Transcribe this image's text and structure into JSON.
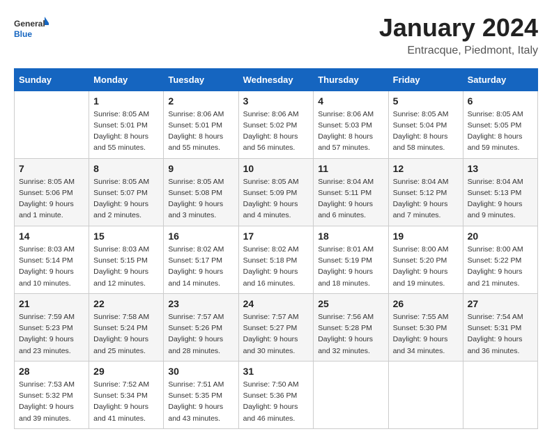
{
  "logo": {
    "general": "General",
    "blue": "Blue"
  },
  "header": {
    "title": "January 2024",
    "subtitle": "Entracque, Piedmont, Italy"
  },
  "columns": [
    "Sunday",
    "Monday",
    "Tuesday",
    "Wednesday",
    "Thursday",
    "Friday",
    "Saturday"
  ],
  "weeks": [
    [
      {
        "day": "",
        "info": ""
      },
      {
        "day": "1",
        "info": "Sunrise: 8:05 AM\nSunset: 5:01 PM\nDaylight: 8 hours\nand 55 minutes."
      },
      {
        "day": "2",
        "info": "Sunrise: 8:06 AM\nSunset: 5:01 PM\nDaylight: 8 hours\nand 55 minutes."
      },
      {
        "day": "3",
        "info": "Sunrise: 8:06 AM\nSunset: 5:02 PM\nDaylight: 8 hours\nand 56 minutes."
      },
      {
        "day": "4",
        "info": "Sunrise: 8:06 AM\nSunset: 5:03 PM\nDaylight: 8 hours\nand 57 minutes."
      },
      {
        "day": "5",
        "info": "Sunrise: 8:05 AM\nSunset: 5:04 PM\nDaylight: 8 hours\nand 58 minutes."
      },
      {
        "day": "6",
        "info": "Sunrise: 8:05 AM\nSunset: 5:05 PM\nDaylight: 8 hours\nand 59 minutes."
      }
    ],
    [
      {
        "day": "7",
        "info": "Sunrise: 8:05 AM\nSunset: 5:06 PM\nDaylight: 9 hours\nand 1 minute."
      },
      {
        "day": "8",
        "info": "Sunrise: 8:05 AM\nSunset: 5:07 PM\nDaylight: 9 hours\nand 2 minutes."
      },
      {
        "day": "9",
        "info": "Sunrise: 8:05 AM\nSunset: 5:08 PM\nDaylight: 9 hours\nand 3 minutes."
      },
      {
        "day": "10",
        "info": "Sunrise: 8:05 AM\nSunset: 5:09 PM\nDaylight: 9 hours\nand 4 minutes."
      },
      {
        "day": "11",
        "info": "Sunrise: 8:04 AM\nSunset: 5:11 PM\nDaylight: 9 hours\nand 6 minutes."
      },
      {
        "day": "12",
        "info": "Sunrise: 8:04 AM\nSunset: 5:12 PM\nDaylight: 9 hours\nand 7 minutes."
      },
      {
        "day": "13",
        "info": "Sunrise: 8:04 AM\nSunset: 5:13 PM\nDaylight: 9 hours\nand 9 minutes."
      }
    ],
    [
      {
        "day": "14",
        "info": "Sunrise: 8:03 AM\nSunset: 5:14 PM\nDaylight: 9 hours\nand 10 minutes."
      },
      {
        "day": "15",
        "info": "Sunrise: 8:03 AM\nSunset: 5:15 PM\nDaylight: 9 hours\nand 12 minutes."
      },
      {
        "day": "16",
        "info": "Sunrise: 8:02 AM\nSunset: 5:17 PM\nDaylight: 9 hours\nand 14 minutes."
      },
      {
        "day": "17",
        "info": "Sunrise: 8:02 AM\nSunset: 5:18 PM\nDaylight: 9 hours\nand 16 minutes."
      },
      {
        "day": "18",
        "info": "Sunrise: 8:01 AM\nSunset: 5:19 PM\nDaylight: 9 hours\nand 18 minutes."
      },
      {
        "day": "19",
        "info": "Sunrise: 8:00 AM\nSunset: 5:20 PM\nDaylight: 9 hours\nand 19 minutes."
      },
      {
        "day": "20",
        "info": "Sunrise: 8:00 AM\nSunset: 5:22 PM\nDaylight: 9 hours\nand 21 minutes."
      }
    ],
    [
      {
        "day": "21",
        "info": "Sunrise: 7:59 AM\nSunset: 5:23 PM\nDaylight: 9 hours\nand 23 minutes."
      },
      {
        "day": "22",
        "info": "Sunrise: 7:58 AM\nSunset: 5:24 PM\nDaylight: 9 hours\nand 25 minutes."
      },
      {
        "day": "23",
        "info": "Sunrise: 7:57 AM\nSunset: 5:26 PM\nDaylight: 9 hours\nand 28 minutes."
      },
      {
        "day": "24",
        "info": "Sunrise: 7:57 AM\nSunset: 5:27 PM\nDaylight: 9 hours\nand 30 minutes."
      },
      {
        "day": "25",
        "info": "Sunrise: 7:56 AM\nSunset: 5:28 PM\nDaylight: 9 hours\nand 32 minutes."
      },
      {
        "day": "26",
        "info": "Sunrise: 7:55 AM\nSunset: 5:30 PM\nDaylight: 9 hours\nand 34 minutes."
      },
      {
        "day": "27",
        "info": "Sunrise: 7:54 AM\nSunset: 5:31 PM\nDaylight: 9 hours\nand 36 minutes."
      }
    ],
    [
      {
        "day": "28",
        "info": "Sunrise: 7:53 AM\nSunset: 5:32 PM\nDaylight: 9 hours\nand 39 minutes."
      },
      {
        "day": "29",
        "info": "Sunrise: 7:52 AM\nSunset: 5:34 PM\nDaylight: 9 hours\nand 41 minutes."
      },
      {
        "day": "30",
        "info": "Sunrise: 7:51 AM\nSunset: 5:35 PM\nDaylight: 9 hours\nand 43 minutes."
      },
      {
        "day": "31",
        "info": "Sunrise: 7:50 AM\nSunset: 5:36 PM\nDaylight: 9 hours\nand 46 minutes."
      },
      {
        "day": "",
        "info": ""
      },
      {
        "day": "",
        "info": ""
      },
      {
        "day": "",
        "info": ""
      }
    ]
  ]
}
